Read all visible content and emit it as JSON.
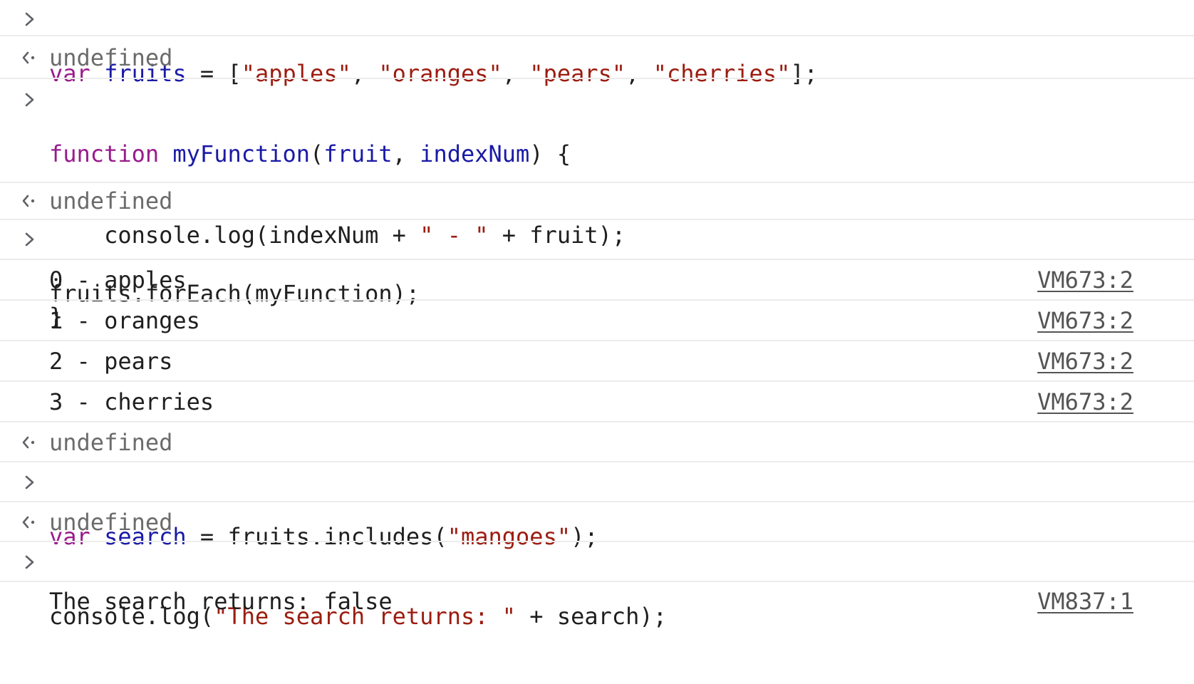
{
  "entries": [
    {
      "type": "input",
      "tokens": [
        [
          "kw",
          "var"
        ],
        [
          "plain",
          " "
        ],
        [
          "var",
          "fruits"
        ],
        [
          "plain",
          " = ["
        ],
        [
          "str",
          "\"apples\""
        ],
        [
          "plain",
          ", "
        ],
        [
          "str",
          "\"oranges\""
        ],
        [
          "plain",
          ", "
        ],
        [
          "str",
          "\"pears\""
        ],
        [
          "plain",
          ", "
        ],
        [
          "str",
          "\"cherries\""
        ],
        [
          "plain",
          "];"
        ]
      ]
    },
    {
      "type": "result",
      "text": "undefined"
    },
    {
      "type": "input",
      "lines": [
        [
          [
            "kw",
            "function"
          ],
          [
            "plain",
            " "
          ],
          [
            "var",
            "myFunction"
          ],
          [
            "plain",
            "("
          ],
          [
            "var",
            "fruit"
          ],
          [
            "plain",
            ", "
          ],
          [
            "var",
            "indexNum"
          ],
          [
            "plain",
            ") {"
          ]
        ],
        [
          [
            "plain",
            "    console.log(indexNum + "
          ],
          [
            "str",
            "\" - \""
          ],
          [
            "plain",
            " + fruit);"
          ]
        ],
        [
          [
            "plain",
            "}"
          ]
        ]
      ]
    },
    {
      "type": "result",
      "text": "undefined"
    },
    {
      "type": "input",
      "tokens": [
        [
          "plain",
          "fruits.forEach(myFunction);"
        ]
      ]
    },
    {
      "type": "log",
      "text": "0 - apples",
      "source": "VM673:2"
    },
    {
      "type": "log",
      "text": "1 - oranges",
      "source": "VM673:2"
    },
    {
      "type": "log",
      "text": "2 - pears",
      "source": "VM673:2"
    },
    {
      "type": "log",
      "text": "3 - cherries",
      "source": "VM673:2"
    },
    {
      "type": "result",
      "text": "undefined"
    },
    {
      "type": "input",
      "tokens": [
        [
          "kw",
          "var"
        ],
        [
          "plain",
          " "
        ],
        [
          "var",
          "search"
        ],
        [
          "plain",
          " = fruits.includes("
        ],
        [
          "str",
          "\"mangoes\""
        ],
        [
          "plain",
          ");"
        ]
      ]
    },
    {
      "type": "result",
      "text": "undefined"
    },
    {
      "type": "input",
      "tokens": [
        [
          "plain",
          "console.log("
        ],
        [
          "str",
          "\"The search returns: \""
        ],
        [
          "plain",
          " + search);"
        ]
      ]
    },
    {
      "type": "log",
      "text": "The search returns: false",
      "source": "VM837:1"
    }
  ],
  "icons": {
    "input": "chevron-right-icon",
    "result": "return-arrow-icon"
  },
  "colors": {
    "keyword": "#9a1a8c",
    "variable": "#1a1aa6",
    "string": "#9c1c10",
    "result": "#6b6b6b",
    "divider": "#ececec"
  }
}
